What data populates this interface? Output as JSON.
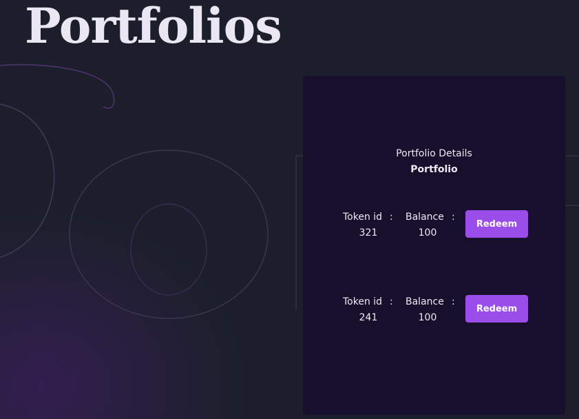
{
  "page": {
    "title": "Portfolios"
  },
  "card": {
    "heading": "Portfolio Details",
    "subheading": "Portfolio"
  },
  "labels": {
    "token_id": "Token id",
    "balance": "Balance",
    "colon": ":"
  },
  "tokens": [
    {
      "token_id": "321",
      "balance": "100",
      "action_label": "Redeem"
    },
    {
      "token_id": "241",
      "balance": "100",
      "action_label": "Redeem"
    }
  ],
  "colors": {
    "background": "#1c1f2b",
    "card": "#170f2b",
    "accent": "#9a4de8",
    "text": "#eeeaf5"
  }
}
